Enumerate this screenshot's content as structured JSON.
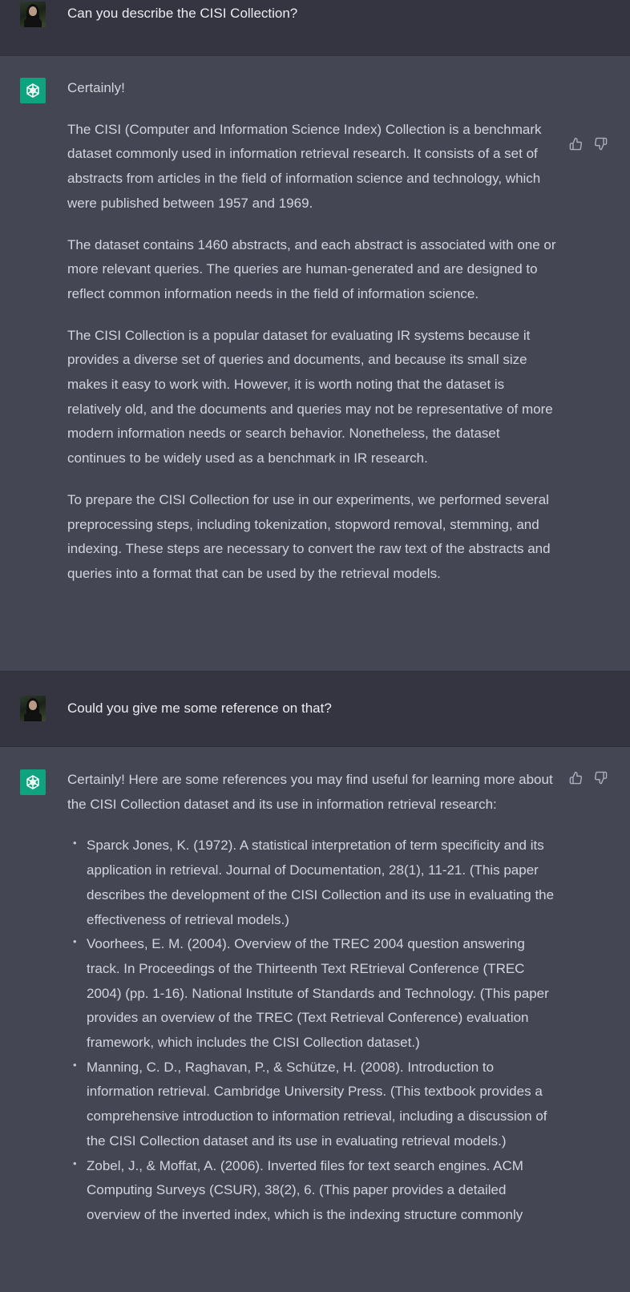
{
  "conversation": {
    "q1": "Can you describe the CISI Collection?",
    "a1": {
      "intro": "Certainly!",
      "paragraphs": [
        "The CISI (Computer and Information Science Index) Collection is a benchmark dataset commonly used in information retrieval research. It consists of a set of abstracts from articles in the field of information science and technology, which were published between 1957 and 1969.",
        "The dataset contains 1460 abstracts, and each abstract is associated with one or more relevant queries. The queries are human-generated and are designed to reflect common information needs in the field of information science.",
        "The CISI Collection is a popular dataset for evaluating IR systems because it provides a diverse set of queries and documents, and because its small size makes it easy to work with. However, it is worth noting that the dataset is relatively old, and the documents and queries may not be representative of more modern information needs or search behavior. Nonetheless, the dataset continues to be widely used as a benchmark in IR research.",
        "To prepare the CISI Collection for use in our experiments, we performed several preprocessing steps, including tokenization, stopword removal, stemming, and indexing. These steps are necessary to convert the raw text of the abstracts and queries into a format that can be used by the retrieval models."
      ]
    },
    "q2": "Could you give me some reference on that?",
    "a2": {
      "intro": "Certainly! Here are some references you may find useful for learning more about the CISI Collection dataset and its use in information retrieval research:",
      "references": [
        "Sparck Jones, K. (1972). A statistical interpretation of term specificity and its application in retrieval. Journal of Documentation, 28(1), 11-21. (This paper describes the development of the CISI Collection and its use in evaluating the effectiveness of retrieval models.)",
        "Voorhees, E. M. (2004). Overview of the TREC 2004 question answering track. In Proceedings of the Thirteenth Text REtrieval Conference (TREC 2004) (pp. 1-16). National Institute of Standards and Technology. (This paper provides an overview of the TREC (Text Retrieval Conference) evaluation framework, which includes the CISI Collection dataset.)",
        "Manning, C. D., Raghavan, P., & Schütze, H. (2008). Introduction to information retrieval. Cambridge University Press. (This textbook provides a comprehensive introduction to information retrieval, including a discussion of the CISI Collection dataset and its use in evaluating retrieval models.)",
        "Zobel, J., & Moffat, A. (2006). Inverted files for text search engines. ACM Computing Surveys (CSUR), 38(2), 6. (This paper provides a detailed overview of the inverted index, which is the indexing structure commonly"
      ]
    }
  },
  "icons": {
    "user_avatar": "user-avatar",
    "bot_avatar": "openai-logo-icon",
    "like": "thumbs-up-icon",
    "dislike": "thumbs-down-icon"
  },
  "colors": {
    "user_bg": "#343541",
    "assistant_bg": "#444654",
    "bot_avatar": "#10a37f",
    "text": "#d1d5db"
  }
}
